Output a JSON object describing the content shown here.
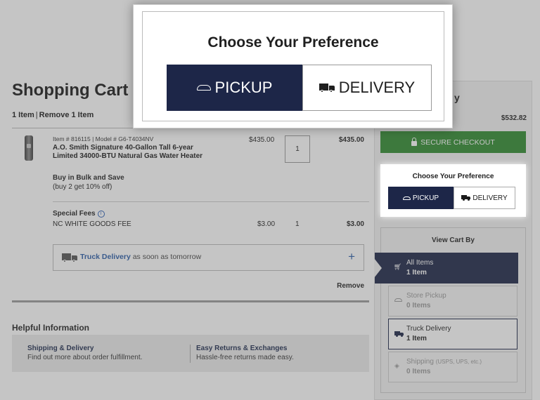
{
  "modal": {
    "title": "Choose Your Preference",
    "pickup_label": "PICKUP",
    "delivery_label": "DELIVERY"
  },
  "cart": {
    "title": "Shopping Cart",
    "item_count": "1 Item",
    "remove_link": "Remove 1 Item",
    "item": {
      "meta": "Item # 816115 | Model # G6-T4034NV",
      "name": "A.O. Smith Signature 40-Gallon Tall 6-year Limited 34000-BTU Natural Gas Water Heater",
      "bulk_title": "Buy in Bulk and Save",
      "bulk_sub": "(buy 2 get 10% off)",
      "unit_price": "$435.00",
      "quantity": "1",
      "total": "$435.00"
    },
    "fees": {
      "title": "Special Fees",
      "name": "NC WHITE GOODS FEE",
      "price": "$3.00",
      "quantity": "1",
      "total": "$3.00"
    },
    "delivery": {
      "method": "Truck Delivery",
      "eta": " as soon as tomorrow",
      "expand": "+"
    },
    "remove": "Remove"
  },
  "helpful": {
    "title": "Helpful Information",
    "col1_title": "Shipping & Delivery",
    "col1_text": "Find out more about order fulfillment.",
    "col2_title": "Easy Returns & Exchanges",
    "col2_text": "Hassle-free returns made easy."
  },
  "summary": {
    "heading_fragment": "y",
    "subtotal": "$532.82",
    "checkout_label": "SECURE CHECKOUT",
    "pref_title": "Choose Your Preference",
    "pref_pickup": "PICKUP",
    "pref_delivery": "DELIVERY",
    "view_title": "View Cart By",
    "view_items": [
      {
        "name": "All Items",
        "count": "1 Item"
      },
      {
        "name": "Store Pickup",
        "count": "0 Items"
      },
      {
        "name": "Truck Delivery",
        "count": "1 Item"
      },
      {
        "name": "Shipping",
        "note": "(USPS, UPS, etc.)",
        "count": "0 Items"
      }
    ]
  },
  "colors": {
    "navy": "#1d2648",
    "green": "#2f8a2f",
    "link_blue": "#2a5da8"
  }
}
